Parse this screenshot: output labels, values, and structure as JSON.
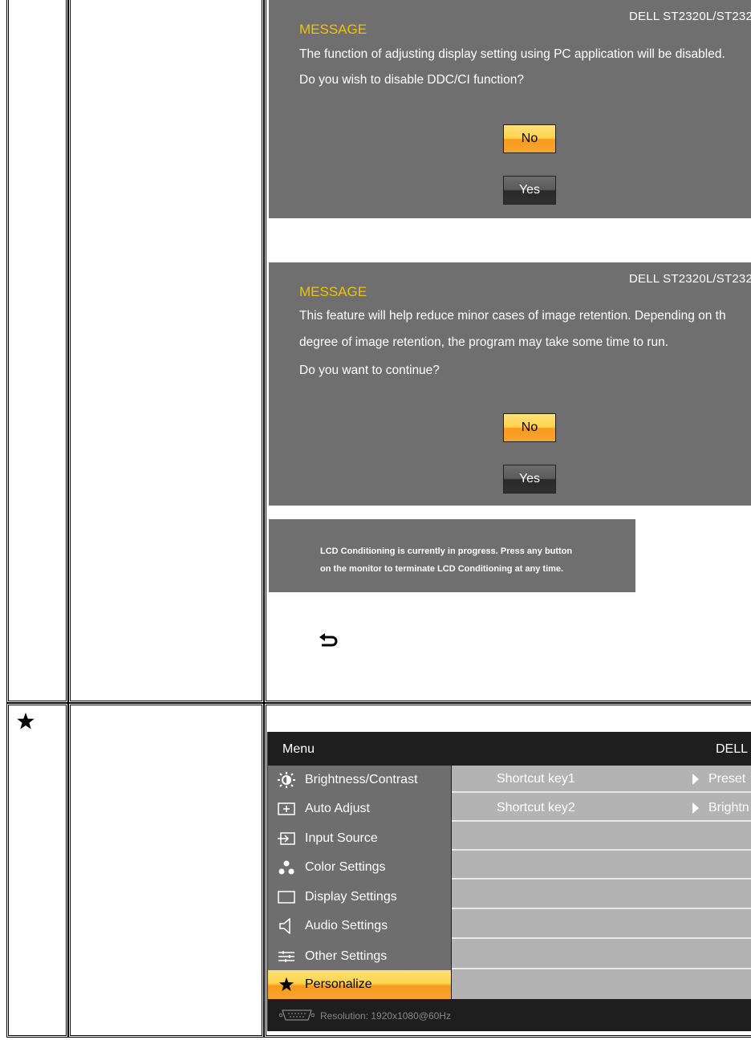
{
  "dialog1": {
    "model": "DELL ST2320L/ST232",
    "title": "MESSAGE",
    "lines": [
      "The function of adjusting display setting using PC application will be disabled.",
      "Do you wish to disable DDC/CI function?"
    ],
    "no_label": "No",
    "yes_label": "Yes"
  },
  "dialog2": {
    "model": "DELL ST2320L/ST232",
    "title": "MESSAGE",
    "lines": [
      "This feature will help reduce minor cases of image retention. Depending on th",
      "degree of image retention, the program may take some time to run.",
      "Do you want to continue?"
    ],
    "no_label": "No",
    "yes_label": "Yes"
  },
  "lcd_notice": {
    "lines": [
      "LCD Conditioning is currently in progress. Press any button",
      "on the monitor to terminate LCD Conditioning at any time."
    ]
  },
  "back_icon": "return-arrow-icon",
  "row2_icon": "star-icon",
  "osd_menu": {
    "title": "Menu",
    "brand": "DELL",
    "items": [
      {
        "label": "Brightness/Contrast",
        "icon": "brightness-icon"
      },
      {
        "label": "Auto Adjust",
        "icon": "auto-adjust-icon"
      },
      {
        "label": "Input Source",
        "icon": "input-source-icon"
      },
      {
        "label": "Color Settings",
        "icon": "color-settings-icon"
      },
      {
        "label": "Display Settings",
        "icon": "display-settings-icon"
      },
      {
        "label": "Audio Settings",
        "icon": "audio-settings-icon"
      },
      {
        "label": "Other Settings",
        "icon": "other-settings-icon"
      },
      {
        "label": "Personalize",
        "icon": "star-icon"
      }
    ],
    "selected": "Personalize",
    "shortcuts": [
      {
        "key": "Shortcut key1",
        "value": "Preset"
      },
      {
        "key": "Shortcut key2",
        "value": "Brightn"
      }
    ],
    "resolution": "Resolution:  1920x1080@60Hz"
  },
  "colors": {
    "accent_yellow": "#f2c200",
    "osd_gray": "#6f6f6f",
    "menu_dark": "#1e1e1e",
    "highlight_orange": "#f89a1e"
  }
}
